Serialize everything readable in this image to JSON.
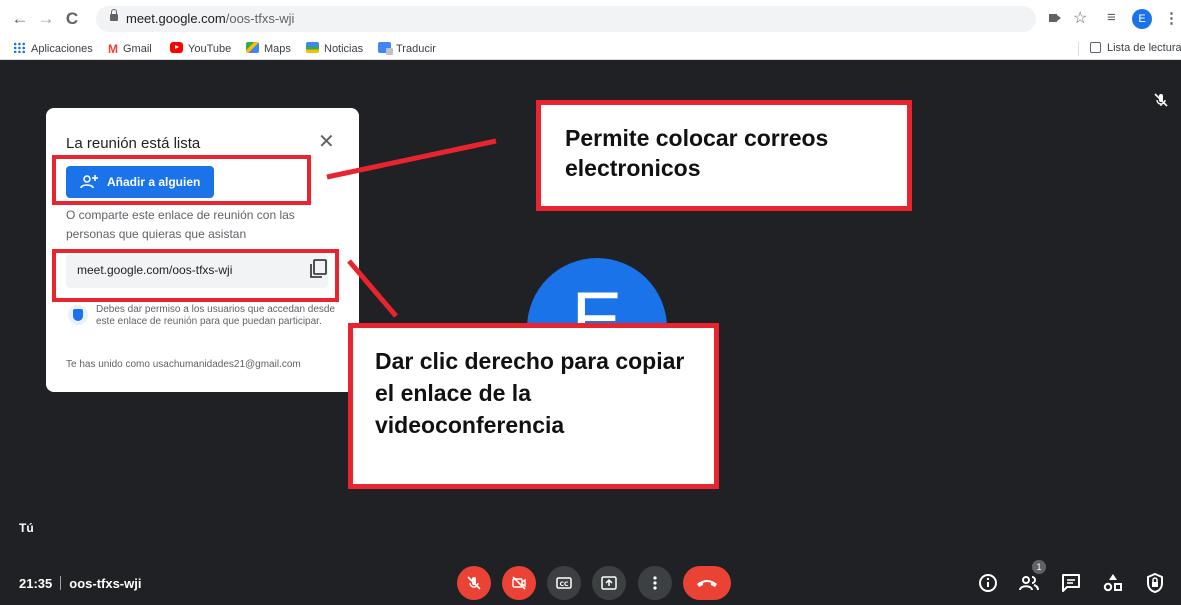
{
  "browser": {
    "url_domain": "meet.google.com",
    "url_path": "/oos-tfxs-wji",
    "profile_initial": "E",
    "bookmarks": [
      "Aplicaciones",
      "Gmail",
      "YouTube",
      "Maps",
      "Noticias",
      "Traducir"
    ],
    "reading_list": "Lista de lectura"
  },
  "panel": {
    "title": "La reunión está lista",
    "add_button": "Añadir a alguien",
    "share_text": "O comparte este enlace de reunión con las personas que quieras que asistan",
    "link": "meet.google.com/oos-tfxs-wji",
    "permission_text": "Debes dar permiso a los usuarios que accedan desde este enlace de reunión para que puedan participar.",
    "joined_text": "Te has unido como usachumanidades21@gmail.com"
  },
  "stage": {
    "avatar_letter": "E",
    "self_label": "Tú"
  },
  "annotations": {
    "top": "Permite colocar correos electronicos",
    "bottom": "Dar clic derecho para copiar el enlace de la videoconferencia"
  },
  "meeting": {
    "time": "21:35",
    "code": "oos-tfxs-wji",
    "participants_count": "1"
  },
  "colors": {
    "annotation": "#e8252f",
    "meet_blue": "#1a73e8",
    "danger": "#ea4335",
    "background": "#202124"
  },
  "icons": [
    "back-icon",
    "forward-icon",
    "reload-icon",
    "lock-icon",
    "camera-icon",
    "star-icon",
    "queue-icon",
    "kebab-icon",
    "mic-off-icon",
    "camera-off-icon",
    "captions-icon",
    "present-icon",
    "more-icon",
    "hangup-icon",
    "info-icon",
    "people-icon",
    "chat-icon",
    "activities-icon",
    "host-controls-icon",
    "copy-icon",
    "shield-icon",
    "close-icon",
    "add-person-icon"
  ]
}
